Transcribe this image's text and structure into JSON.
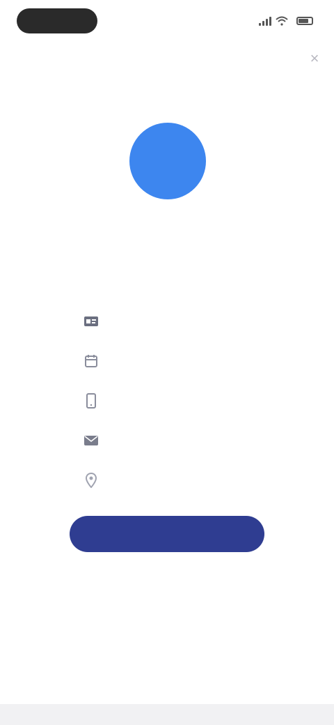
{
  "status_bar": {
    "time": "",
    "battery": ""
  },
  "header": {
    "title": "",
    "close_glyph": "×"
  },
  "profile": {
    "avatar_initials": "",
    "name": "",
    "meta_left": "",
    "meta_right": ""
  },
  "info_list": [
    {
      "icon": "id-card-icon",
      "text": ""
    },
    {
      "icon": "calendar-icon",
      "text": ""
    },
    {
      "icon": "phone-icon",
      "text": ""
    },
    {
      "icon": "mail-icon",
      "text": ""
    },
    {
      "icon": "location-pin-icon",
      "text": ""
    }
  ],
  "action_button": {
    "label": ""
  },
  "footer": {
    "link_text": ""
  },
  "colors": {
    "accent": "#3d86ef",
    "button": "#2f3d91",
    "text": "#55596e"
  }
}
